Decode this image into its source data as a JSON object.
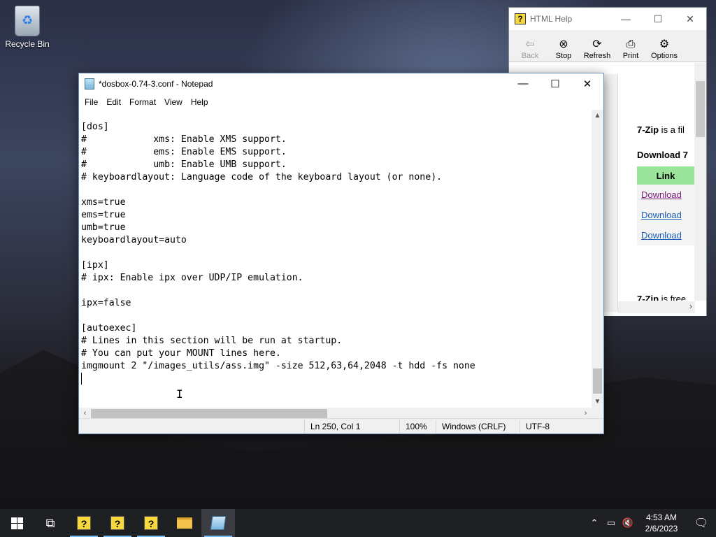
{
  "desktop": {
    "recycle_bin_label": "Recycle Bin"
  },
  "help_window": {
    "title": "HTML Help",
    "toolbar": {
      "back": "Back",
      "stop": "Stop",
      "refresh": "Refresh",
      "print": "Print",
      "options": "Options"
    },
    "content": {
      "line1_bold": "7-Zip",
      "line1_rest": " is a fil",
      "line2": "Download 7",
      "table_header": "Link",
      "links": [
        "Download",
        "Download",
        "Download"
      ],
      "line3_bold": "7-Zip",
      "line3_rest": " is free"
    }
  },
  "notepad": {
    "title": "*dosbox-0.74-3.conf - Notepad",
    "menu": [
      "File",
      "Edit",
      "Format",
      "View",
      "Help"
    ],
    "lines": [
      "[dos]",
      "#            xms: Enable XMS support.",
      "#            ems: Enable EMS support.",
      "#            umb: Enable UMB support.",
      "# keyboardlayout: Language code of the keyboard layout (or none).",
      "",
      "xms=true",
      "ems=true",
      "umb=true",
      "keyboardlayout=auto",
      "",
      "[ipx]",
      "# ipx: Enable ipx over UDP/IP emulation.",
      "",
      "ipx=false",
      "",
      "[autoexec]",
      "# Lines in this section will be run at startup.",
      "# You can put your MOUNT lines here.",
      "imgmount 2 \"/images_utils/ass.img\" -size 512,63,64,2048 -t hdd -fs none"
    ],
    "status": {
      "position": "Ln 250, Col 1",
      "zoom": "100%",
      "line_ending": "Windows (CRLF)",
      "encoding": "UTF-8"
    }
  },
  "taskbar": {
    "time": "4:53 AM",
    "date": "2/6/2023"
  }
}
